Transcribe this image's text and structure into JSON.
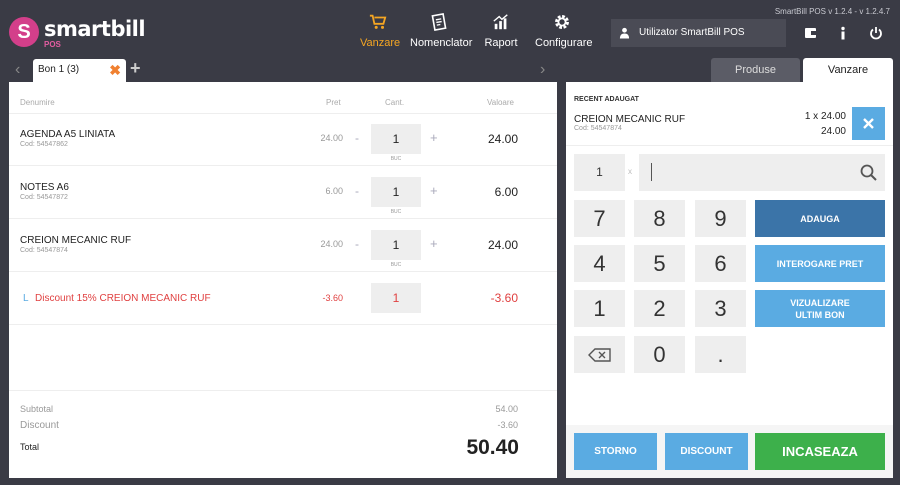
{
  "app": {
    "logo_letter": "S",
    "logo_name": "smartbill",
    "logo_sub": "POS",
    "version": "SmartBill POS  v 1.2.4   -   v 1.2.4.7"
  },
  "nav": [
    {
      "label": "Vanzare",
      "icon": "cart-icon",
      "active": true
    },
    {
      "label": "Nomenclator",
      "icon": "document-icon"
    },
    {
      "label": "Raport",
      "icon": "chart-icon"
    },
    {
      "label": "Configurare",
      "icon": "gear-icon"
    }
  ],
  "user": {
    "name": "Utilizator SmartBill POS"
  },
  "tabs": {
    "bon": "Bon 1  (3)",
    "bon_close": "✖",
    "add": "+",
    "produse": "Produse",
    "vanzare": "Vanzare"
  },
  "table": {
    "headers": [
      "Denumire",
      "Pret",
      "Cant.",
      "Valoare"
    ],
    "rows": [
      {
        "name": "AGENDA A5 LINIATA",
        "code": "Cod: 54547862",
        "price": "24.00",
        "qty": "1",
        "unit": "BUC",
        "value": "24.00"
      },
      {
        "name": "NOTES A6",
        "code": "Cod: 54547872",
        "price": "6.00",
        "qty": "1",
        "unit": "BUC",
        "value": "6.00"
      },
      {
        "name": "CREION MECANIC RUF",
        "code": "Cod: 54547874",
        "price": "24.00",
        "qty": "1",
        "unit": "BUC",
        "value": "24.00"
      }
    ],
    "discount": {
      "marker": "L",
      "name": "Discount 15% CREION MECANIC RUF",
      "price": "-3.60",
      "qty": "1",
      "value": "-3.60"
    },
    "minus": "-",
    "plus": "+"
  },
  "totals": {
    "subtotal_label": "Subtotal",
    "subtotal": "54.00",
    "discount_label": "Discount",
    "discount": "-3.60",
    "total_label": "Total",
    "total": "50.40"
  },
  "recent": {
    "title": "RECENT ADAUGAT",
    "name": "CREION MECANIC RUF",
    "code": "Cod: 54547874",
    "qty_line": "1 x 24.00",
    "total": "24.00"
  },
  "keypad": {
    "qty": "1",
    "times": "x",
    "search_value": "",
    "keys": [
      "7",
      "8",
      "9",
      "4",
      "5",
      "6",
      "1",
      "2",
      "3",
      "",
      "0",
      "."
    ]
  },
  "actions": {
    "adauga": "ADAUGA",
    "interogare": "INTEROGARE PRET",
    "vizualizare1": "VIZUALIZARE",
    "vizualizare2": "ULTIM BON"
  },
  "bottom": {
    "storno": "STORNO",
    "discount": "DISCOUNT",
    "incaseaza": "INCASEAZA"
  },
  "colors": {
    "accent": "#f5a623",
    "blue": "#5aabe2",
    "dark_blue": "#3b74a8",
    "green": "#3db04b",
    "red": "#e04040"
  }
}
